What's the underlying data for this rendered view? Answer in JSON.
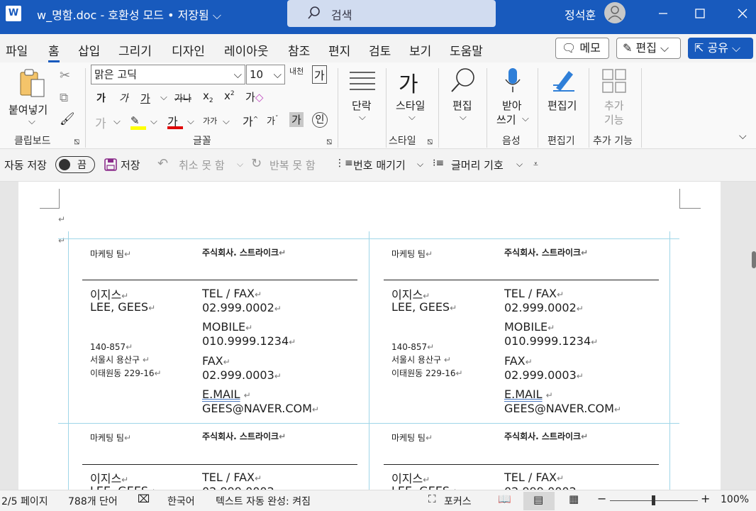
{
  "titlebar": {
    "app_logo": "W",
    "doc_title": "w_명함.doc  -  호환성 모드 • 저장됨 ⌵",
    "search_placeholder": "검색",
    "user_name": "정석훈"
  },
  "menu": {
    "tabs": [
      "파일",
      "홈",
      "삽입",
      "그리기",
      "디자인",
      "레이아웃",
      "참조",
      "편지",
      "검토",
      "보기",
      "도움말"
    ],
    "memo_label": "메모",
    "edit_label": "편집",
    "share_label": "공유"
  },
  "ribbon": {
    "paste_label": "붙여넣기",
    "clipboard_group": "클립보드",
    "font_name": "맑은 고딕",
    "font_size": "10",
    "font_group": "글꼴",
    "paragraph_label": "단락",
    "style_label": "스타일",
    "style_group": "스타일",
    "edit_label": "편집",
    "dictate_label_1": "받아",
    "dictate_label_2": "쓰기",
    "voice_group": "음성",
    "editor_label": "편집기",
    "editor_group": "편집기",
    "addin_label_1": "추가",
    "addin_label_2": "기능",
    "addin_group": "추가 기능",
    "highlight_color": "#ffff00",
    "font_color": "#e00000"
  },
  "qat": {
    "autosave_label": "자동 저장",
    "autosave_state": "끔",
    "save_label": "저장",
    "undo_label": "취소 못 함",
    "redo_label": "반복 못 함",
    "numbering_label": "번호 매기기",
    "bullets_label": "글머리 기호"
  },
  "card": {
    "team": "마케팅 팀",
    "company": "주식회사. 스트라이크",
    "name_kr": "이지스",
    "name_en": "LEE, GEES",
    "zip": "140-857",
    "addr1": "서울시 용산구",
    "addr2": "이태원동 229-16",
    "tel_label": "TEL / FAX",
    "tel": "02.999.0002",
    "mobile_label": "MOBILE",
    "mobile": "010.9999.1234",
    "fax_label": "FAX",
    "fax": "02.999.0003",
    "email_label": "E.MAIL",
    "email": "GEES@NAVER.COM",
    "return_mark": "↵"
  },
  "status": {
    "page": "2/5 페이지",
    "words": "788개 단어",
    "language": "한국어",
    "autocomplete": "텍스트 자동 완성: 켜짐",
    "focus": "포커스",
    "zoom": "100%"
  }
}
